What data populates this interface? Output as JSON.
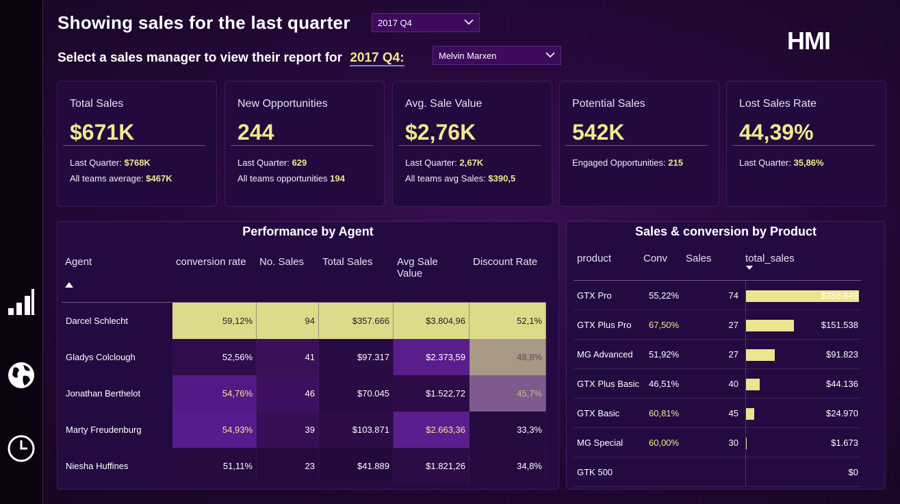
{
  "header": {
    "title": "Showing sales for the last quarter",
    "quarter_select": "2017 Q4",
    "subtitle": "Select a sales manager to view their report for",
    "subtitle_quarter": "2017 Q4:",
    "manager_select": "Melvin Marxen",
    "logo_text": "HMI"
  },
  "kpis": [
    {
      "label": "Total Sales",
      "value": "$671K",
      "l1_label": "Last Quarter:",
      "l1_value": "$768K",
      "l2_label": "All teams average:",
      "l2_value": "$467K"
    },
    {
      "label": "New Opportunities",
      "value": "244",
      "l1_label": "Last Quarter:",
      "l1_value": "629",
      "l2_label": "All teams opportunities",
      "l2_value": "194"
    },
    {
      "label": "Avg. Sale Value",
      "value": "$2,76K",
      "l1_label": "Last Quarter:",
      "l1_value": "2,67K",
      "l2_label": "All teams avg Sales:",
      "l2_value": "$390,5"
    },
    {
      "label": "Potential Sales",
      "value": "542K",
      "l1_label": "Engaged Opportunities:",
      "l1_value": "215"
    },
    {
      "label": "Lost Sales Rate",
      "value": "44,39%",
      "l1_label": "Last Quarter:",
      "l1_value": "35,86%"
    }
  ],
  "agents": {
    "title": "Performance by Agent",
    "headers": [
      "Agent",
      "conversion rate",
      "No. Sales",
      "Total Sales",
      "Avg Sale",
      "Value",
      "Discount Rate"
    ],
    "rows": [
      {
        "name": "Darcel Schlecht",
        "conv": "59,12%",
        "sales": "94",
        "total": "$357.666",
        "avg": "$3.804,96",
        "disc": "52,1%"
      },
      {
        "name": "Gladys Colclough",
        "conv": "52,56%",
        "sales": "41",
        "total": "$97.317",
        "avg": "$2.373,59",
        "disc": "48,8%"
      },
      {
        "name": "Jonathan Berthelot",
        "conv": "54,76%",
        "sales": "46",
        "total": "$70.045",
        "avg": "$1.522,72",
        "disc": "45,7%"
      },
      {
        "name": "Marty Freudenburg",
        "conv": "54,93%",
        "sales": "39",
        "total": "$103.871",
        "avg": "$2.663,36",
        "disc": "33,3%"
      },
      {
        "name": "Niesha Huffines",
        "conv": "51,11%",
        "sales": "23",
        "total": "$41.889",
        "avg": "$1.821,26",
        "disc": "34,8%"
      }
    ]
  },
  "products": {
    "title": "Sales & conversion by Product",
    "headers": [
      "product",
      "Conv",
      "Sales",
      "total_sales"
    ],
    "rows": [
      {
        "name": "GTX Pro",
        "conv": "55,22%",
        "sales": "74",
        "total": "$356.649",
        "fraction": 1.0
      },
      {
        "name": "GTX Plus Pro",
        "conv": "67,50%",
        "sales": "27",
        "total": "$151.538",
        "fraction": 0.425
      },
      {
        "name": "MG Advanced",
        "conv": "51,92%",
        "sales": "27",
        "total": "$91.823",
        "fraction": 0.257
      },
      {
        "name": "GTX Plus Basic",
        "conv": "46,51%",
        "sales": "40",
        "total": "$44.136",
        "fraction": 0.124
      },
      {
        "name": "GTX Basic",
        "conv": "60,81%",
        "sales": "45",
        "total": "$24.970",
        "fraction": 0.07
      },
      {
        "name": "MG Special",
        "conv": "60,00%",
        "sales": "30",
        "total": "$1.673",
        "fraction": 0.005
      },
      {
        "name": "GTK 500",
        "conv": "",
        "sales": "",
        "total": "$0",
        "fraction": 0
      }
    ]
  },
  "colors": {
    "highlight": "#f2e88c",
    "bar": "#ece58f",
    "panel": "#230b42"
  }
}
